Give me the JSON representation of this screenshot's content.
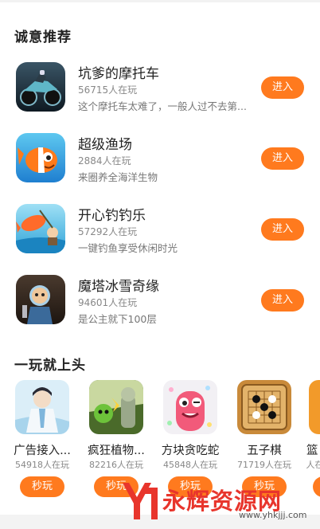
{
  "sections": {
    "recommended_title": "诚意推荐",
    "addictive_title": "一玩就上头"
  },
  "recommended": [
    {
      "name": "坑爹的摩托车",
      "players": "56715人在玩",
      "desc": "这个摩托车太难了，一般人过不去第...",
      "button": "进入",
      "icon": "motorcycle-game-icon"
    },
    {
      "name": "超级渔场",
      "players": "2884人在玩",
      "desc": "来圈养全海洋生物",
      "button": "进入",
      "icon": "clownfish-game-icon"
    },
    {
      "name": "开心钓钓乐",
      "players": "57292人在玩",
      "desc": "一键钓鱼享受休闲时光",
      "button": "进入",
      "icon": "fishing-game-icon"
    },
    {
      "name": "魔塔冰雪奇缘",
      "players": "94601人在玩",
      "desc": "是公主就下100层",
      "button": "进入",
      "icon": "magic-tower-game-icon"
    }
  ],
  "addictive": [
    {
      "name": "广告接入...",
      "players": "54918人在玩",
      "button": "秒玩",
      "icon": "ad-game-icon"
    },
    {
      "name": "疯狂植物...",
      "players": "82216人在玩",
      "button": "秒玩",
      "icon": "plants-game-icon"
    },
    {
      "name": "方块贪吃蛇",
      "players": "45848人在玩",
      "button": "秒玩",
      "icon": "snake-game-icon"
    },
    {
      "name": "五子棋",
      "players": "71719人在玩",
      "button": "秒玩",
      "icon": "gomoku-game-icon"
    },
    {
      "name": "篮",
      "players": "人在玩",
      "button": "秒玩",
      "icon": "basketball-game-icon"
    }
  ],
  "watermark": {
    "text": "永辉资源网",
    "url": "www.yhkjjj.com"
  },
  "colors": {
    "accent": "#ff7a1e",
    "watermark": "#e8352c"
  }
}
